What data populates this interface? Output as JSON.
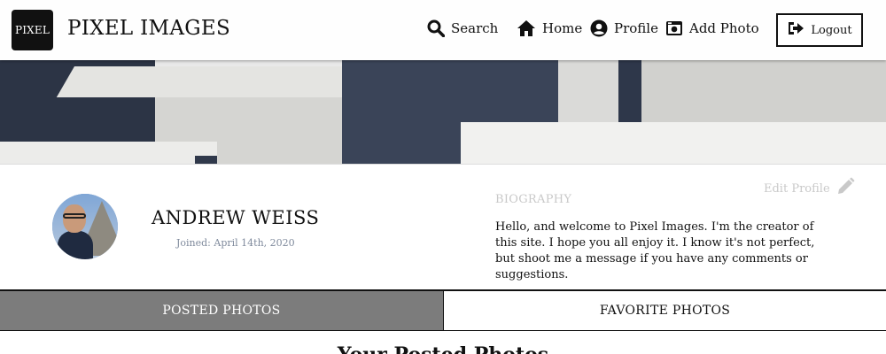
{
  "header": {
    "logo_text": "PIXEL",
    "brand": "PIXEL IMAGES",
    "nav": {
      "search": "Search",
      "home": "Home",
      "profile": "Profile",
      "add_photo": "Add Photo"
    },
    "logout": "Logout"
  },
  "profile": {
    "name": "ANDREW WEISS",
    "joined": "Joined: April 14th, 2020",
    "biography_heading": "BIOGRAPHY",
    "edit_profile": "Edit Profile",
    "biography": "Hello, and welcome to Pixel Images. I'm the creator of this site. I hope you all enjoy it. I know it's not perfect, but shoot me a message if you have any comments or suggestions."
  },
  "tabs": {
    "posted": "POSTED PHOTOS",
    "favorite": "FAVORITE PHOTOS",
    "active": "posted"
  },
  "main": {
    "section_title": "Your Posted Photos"
  },
  "colors": {
    "active_tab": "#7c7c7c",
    "muted_text": "#c9c9c9",
    "joined_text": "#7f8a9c"
  }
}
